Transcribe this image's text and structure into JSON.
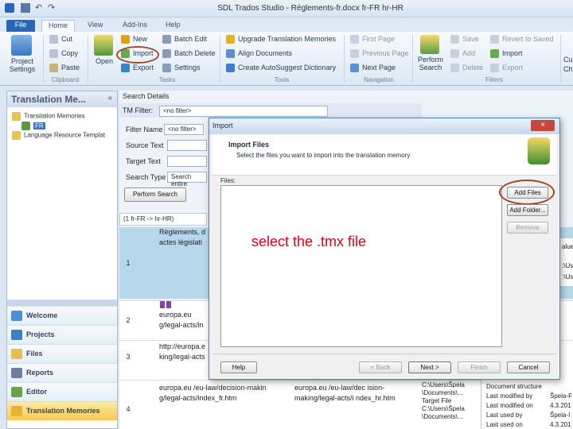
{
  "window": {
    "title": "SDL Trados Studio - Réglements-fr.docx fr-FR hr-HR"
  },
  "ribbon": {
    "tabs": [
      "File",
      "Home",
      "View",
      "Add-Ins",
      "Help"
    ],
    "project_settings": "Project Settings",
    "open": "Open",
    "clipboard": {
      "cut": "Cut",
      "copy": "Copy",
      "paste": "Paste",
      "group": "Clipboard"
    },
    "tasks": {
      "new": "New",
      "import": "Import",
      "export": "Export",
      "batch_edit": "Batch Edit",
      "batch_delete": "Batch Delete",
      "settings": "Settings",
      "group": "Tasks"
    },
    "tools": {
      "upgrade": "Upgrade Translation Memories",
      "align": "Align Documents",
      "autosuggest": "Create AutoSuggest Dictionary",
      "group": "Tools"
    },
    "navigation": {
      "first": "First Page",
      "previous": "Previous Page",
      "next": "Next Page",
      "group": "Navigation"
    },
    "filters": {
      "perform_search": "Perform Search",
      "save": "Save",
      "add": "Add",
      "delete": "Delete",
      "revert": "Revert to Saved",
      "import": "Import",
      "export": "Export",
      "group": "Filters"
    },
    "right_cut_1": "Cu",
    "right_cut_2": "Ch"
  },
  "nav": {
    "title": "Translation Me...",
    "tree": {
      "tm_root": "Translation Memories",
      "tm_item": "FR",
      "lr_root": "Language Resource Templat"
    },
    "buttons": [
      "Welcome",
      "Projects",
      "Files",
      "Reports",
      "Editor",
      "Translation Memories"
    ]
  },
  "search": {
    "header": "Search Details",
    "tm_filter_label": "TM Filter:",
    "tm_filter_value": "<no filter>",
    "filter_name_label": "Filter Name",
    "filter_name_value": "<no filter>",
    "source_text_label": "Source Text",
    "target_text_label": "Target Text",
    "search_type_label": "Search Type",
    "search_type_value": "Search entire",
    "perform_search": "Perform Search",
    "col_header": "(1 fr-FR -> hr-HR)"
  },
  "grid": {
    "rows": [
      {
        "num": "1",
        "source": "Règlements, d actes législati"
      },
      {
        "num": "2",
        "source": "europa.eu g/legal-acts/in"
      },
      {
        "num": "3",
        "source": "http://europa.e king/legal-acts"
      },
      {
        "num": "4",
        "source": "europa.eu /eu-law/decision-makin g/legal-acts/index_fr.htm",
        "target": "europa.eu /eu-law/dec ision-making/legal-acts/i ndex_hr.htm",
        "meta1": "C:\\Users\\Špela",
        "meta2": "\\Documents\\...",
        "meta3": "Target File",
        "meta4": "C:\\Users\\Špela",
        "meta5": "\\Documents\\..."
      }
    ]
  },
  "dialog": {
    "title": "Import",
    "heading": "Import Files",
    "subheading": "Select the files you want to import into the translation memory",
    "files_label": "Files:",
    "add_files": "Add Files",
    "add_folder": "Add Folder...",
    "remove": "Remove",
    "help": "Help",
    "back": "< Back",
    "next": "Next >",
    "finish": "Finish",
    "cancel": "Cancel"
  },
  "annotation": "select the .tmx file",
  "right_panel": {
    "items": [
      "Document structure",
      "Last modified by",
      "Last modified on",
      "Last used by",
      "Last used on"
    ],
    "values": [
      "",
      "Špela-F",
      "4.3.201",
      "Špela-I",
      "4.3.201"
    ],
    "side_values": [
      "alue",
      ":\\Us",
      ":\\Us"
    ]
  }
}
